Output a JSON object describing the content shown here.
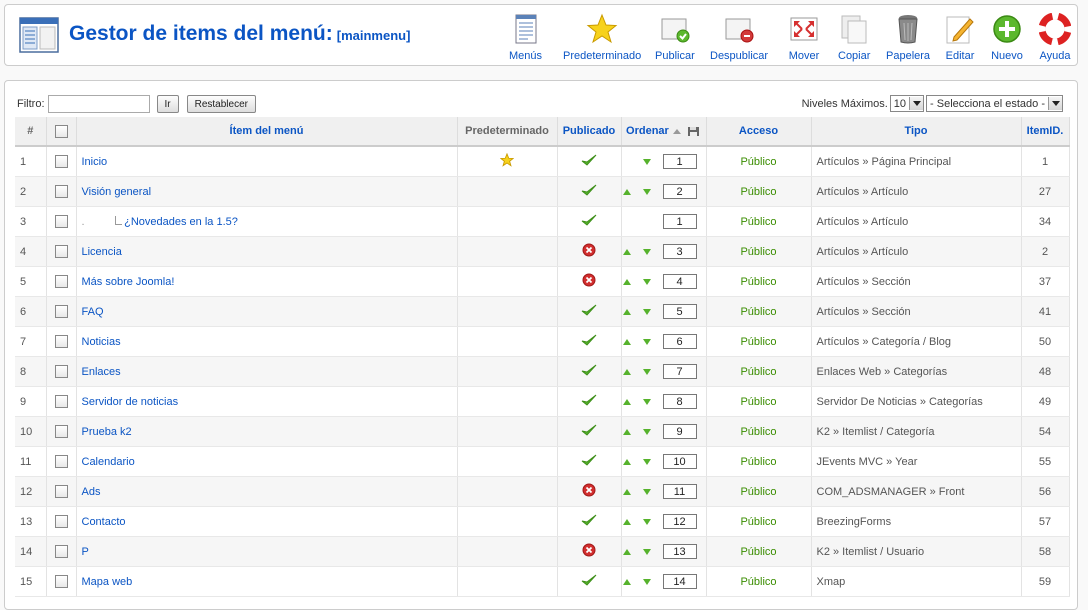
{
  "header": {
    "title": "Gestor de items del menú:",
    "subtitle": "[mainmenu]",
    "buttons": [
      {
        "label": "Menús",
        "icon": "menus-icon"
      },
      {
        "label": "Predeterminado",
        "icon": "star-icon"
      },
      {
        "label": "Publicar",
        "icon": "publish-icon"
      },
      {
        "label": "Despublicar",
        "icon": "unpublish-icon"
      },
      {
        "label": "Mover",
        "icon": "move-icon"
      },
      {
        "label": "Copiar",
        "icon": "copy-icon"
      },
      {
        "label": "Papelera",
        "icon": "trash-icon"
      },
      {
        "label": "Editar",
        "icon": "edit-icon"
      },
      {
        "label": "Nuevo",
        "icon": "new-icon"
      },
      {
        "label": "Ayuda",
        "icon": "help-icon"
      }
    ]
  },
  "filter": {
    "label": "Filtro:",
    "value": "",
    "go_label": "Ir",
    "reset_label": "Restablecer",
    "levels_label": "Niveles Máximos.",
    "levels_value": "10",
    "state_value": "- Selecciona el estado -"
  },
  "columns": {
    "num": "#",
    "item": "Ítem del menú",
    "default": "Predeterminado",
    "published": "Publicado",
    "order": "Ordenar",
    "access": "Acceso",
    "type": "Tipo",
    "itemid": "ItemID."
  },
  "colors": {
    "link": "#0b55c4",
    "access_green": "#3a8d00",
    "published_green": "#56b22c",
    "unpublished_red": "#d12e2e"
  },
  "rows": [
    {
      "num": "1",
      "name": "Inicio",
      "indent": false,
      "default": true,
      "published": true,
      "up": false,
      "down": true,
      "order": "1",
      "access": "Público",
      "type": "Artículos » Página Principal",
      "itemid": "1"
    },
    {
      "num": "2",
      "name": "Visión general",
      "indent": false,
      "default": false,
      "published": true,
      "up": true,
      "down": true,
      "order": "2",
      "access": "Público",
      "type": "Artículos » Artículo",
      "itemid": "27"
    },
    {
      "num": "3",
      "name": "¿Novedades en la 1.5?",
      "indent": true,
      "default": false,
      "published": true,
      "up": false,
      "down": false,
      "order": "1",
      "access": "Público",
      "type": "Artículos » Artículo",
      "itemid": "34"
    },
    {
      "num": "4",
      "name": "Licencia",
      "indent": false,
      "default": false,
      "published": false,
      "up": true,
      "down": true,
      "order": "3",
      "access": "Público",
      "type": "Artículos » Artículo",
      "itemid": "2"
    },
    {
      "num": "5",
      "name": "Más sobre Joomla!",
      "indent": false,
      "default": false,
      "published": false,
      "up": true,
      "down": true,
      "order": "4",
      "access": "Público",
      "type": "Artículos » Sección",
      "itemid": "37"
    },
    {
      "num": "6",
      "name": "FAQ",
      "indent": false,
      "default": false,
      "published": true,
      "up": true,
      "down": true,
      "order": "5",
      "access": "Público",
      "type": "Artículos » Sección",
      "itemid": "41"
    },
    {
      "num": "7",
      "name": "Noticias",
      "indent": false,
      "default": false,
      "published": true,
      "up": true,
      "down": true,
      "order": "6",
      "access": "Público",
      "type": "Artículos » Categoría / Blog",
      "itemid": "50"
    },
    {
      "num": "8",
      "name": "Enlaces",
      "indent": false,
      "default": false,
      "published": true,
      "up": true,
      "down": true,
      "order": "7",
      "access": "Público",
      "type": "Enlaces Web » Categorías",
      "itemid": "48"
    },
    {
      "num": "9",
      "name": "Servidor de noticias",
      "indent": false,
      "default": false,
      "published": true,
      "up": true,
      "down": true,
      "order": "8",
      "access": "Público",
      "type": "Servidor De Noticias » Categorías",
      "itemid": "49"
    },
    {
      "num": "10",
      "name": "Prueba k2",
      "indent": false,
      "default": false,
      "published": true,
      "up": true,
      "down": true,
      "order": "9",
      "access": "Público",
      "type": "K2 » Itemlist / Categoría",
      "itemid": "54"
    },
    {
      "num": "11",
      "name": "Calendario",
      "indent": false,
      "default": false,
      "published": true,
      "up": true,
      "down": true,
      "order": "10",
      "access": "Público",
      "type": "JEvents MVC » Year",
      "itemid": "55"
    },
    {
      "num": "12",
      "name": "Ads",
      "indent": false,
      "default": false,
      "published": false,
      "up": true,
      "down": true,
      "order": "11",
      "access": "Público",
      "type": "COM_ADSMANAGER » Front",
      "itemid": "56"
    },
    {
      "num": "13",
      "name": "Contacto",
      "indent": false,
      "default": false,
      "published": true,
      "up": true,
      "down": true,
      "order": "12",
      "access": "Público",
      "type": "BreezingForms",
      "itemid": "57"
    },
    {
      "num": "14",
      "name": "P",
      "indent": false,
      "default": false,
      "published": false,
      "up": true,
      "down": true,
      "order": "13",
      "access": "Público",
      "type": "K2 » Itemlist / Usuario",
      "itemid": "58"
    },
    {
      "num": "15",
      "name": "Mapa web",
      "indent": false,
      "default": false,
      "published": true,
      "up": true,
      "down": true,
      "order": "14",
      "access": "Público",
      "type": "Xmap",
      "itemid": "59"
    }
  ]
}
